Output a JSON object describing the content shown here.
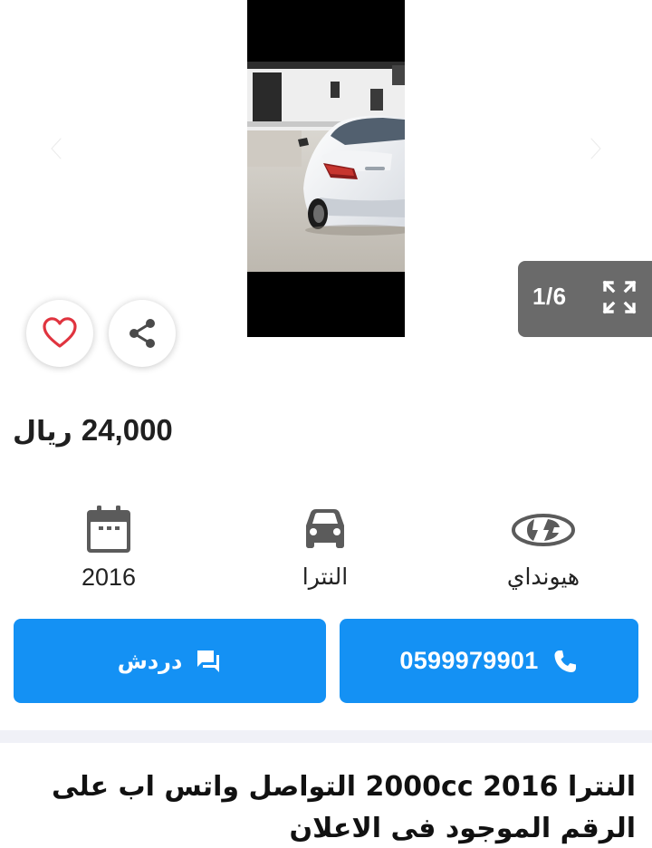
{
  "gallery": {
    "counter": "1/6",
    "prev_icon": "chevron-left-icon",
    "next_icon": "chevron-right-icon",
    "expand_icon": "expand-icon"
  },
  "actions": {
    "favorite_icon": "heart-icon",
    "share_icon": "share-icon",
    "chat_label": "دردش",
    "phone_number": "0599979901"
  },
  "price": {
    "value": "24,000",
    "currency": "ريال"
  },
  "specs": {
    "year": "2016",
    "model": "النترا",
    "brand": "هيونداي"
  },
  "description": "النترا 2016 2000cc التواصل واتس اب على الرقم الموجود فى الاعلان",
  "colors": {
    "accent": "#1491f4",
    "heart": "#e0343f",
    "counter_bg": "#6a6a6a",
    "divider": "#f0f1f7"
  }
}
